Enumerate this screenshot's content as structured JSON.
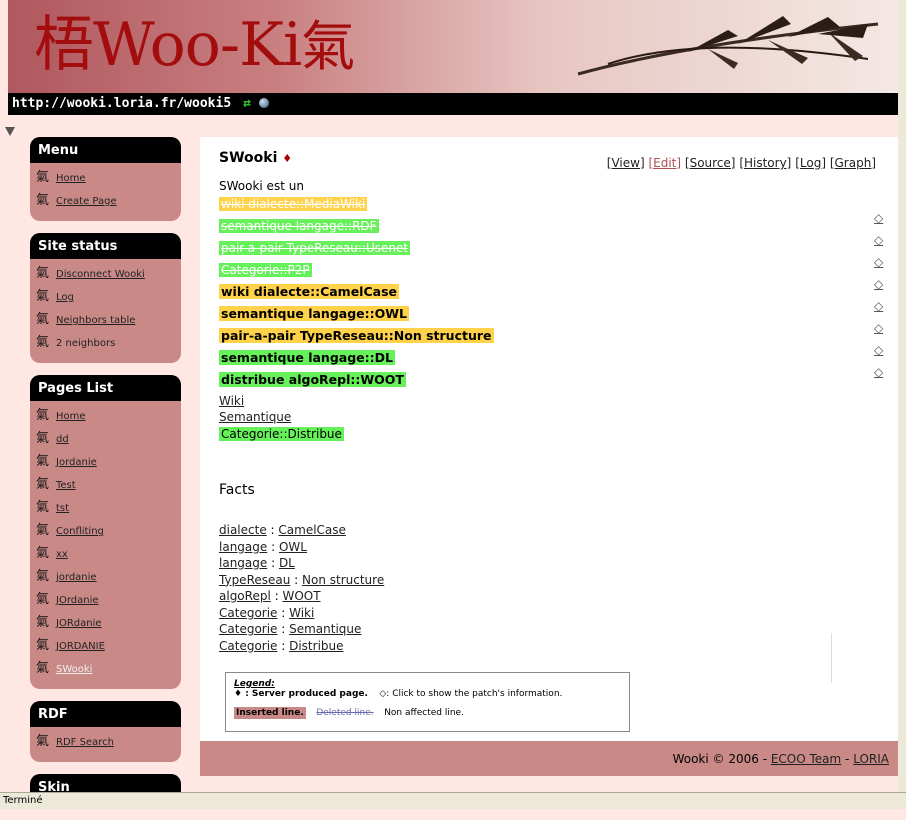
{
  "header": {
    "logo_prefix": "梧",
    "logo_main": "Woo-Ki",
    "logo_suffix": "氣",
    "url": "http://wooki.loria.fr/wooki5"
  },
  "sidebar": {
    "menu": {
      "title": "Menu",
      "items": [
        "Home",
        "Create Page"
      ]
    },
    "site_status": {
      "title": "Site status",
      "items": [
        "Disconnect Wooki",
        "Log",
        "Neighbors table",
        "2 neighbors"
      ]
    },
    "pages_list": {
      "title": "Pages List",
      "items": [
        "Home",
        "dd",
        "Jordanie",
        "Test",
        "tst",
        "Confliting",
        "xx",
        "jordanie",
        "JOrdanie",
        "JORdanie",
        "JORDANIE",
        "SWooki"
      ]
    },
    "rdf": {
      "title": "RDF",
      "items": [
        "RDF Search"
      ]
    },
    "skin": {
      "title": "Skin"
    },
    "item_icon": "氣"
  },
  "page": {
    "title": "SWooki",
    "title_mark": "♦",
    "actions": [
      "[View]",
      "[Edit]",
      "[Source]",
      "[History]",
      "[Log]",
      "[Graph]"
    ],
    "intro": "SWooki est un",
    "deleted_lines": [
      "wiki dialecte::MediaWiki",
      "semantique langage::RDF",
      "pair-a-pair TypeReseau::Usenet",
      "Categorie::P2P"
    ],
    "inserted_lines": [
      "wiki dialecte::CamelCase",
      "semantique langage::OWL",
      "pair-a-pair TypeReseau::Non structure",
      "semantique langage::DL",
      "distribue algoRepl::WOOT"
    ],
    "plain_links": [
      "Wiki",
      "Semantique"
    ],
    "category_line": "Categorie::Distribue",
    "patch_icon": "◇"
  },
  "facts": {
    "title": "Facts",
    "rows": [
      {
        "prop": "dialecte",
        "val": "CamelCase"
      },
      {
        "prop": "langage",
        "val": "OWL"
      },
      {
        "prop": "langage",
        "val": "DL"
      },
      {
        "prop": "TypeReseau",
        "val": "Non structure"
      },
      {
        "prop": "algoRepl",
        "val": "WOOT"
      },
      {
        "prop": "Categorie",
        "val": "Wiki"
      },
      {
        "prop": "Categorie",
        "val": "Semantique"
      },
      {
        "prop": "Categorie",
        "val": "Distribue"
      }
    ],
    "separator": " : "
  },
  "legend": {
    "title": "Legend:",
    "server_mark": "♦ : Server produced page.",
    "patch_info": "◇: Click to show the patch's information.",
    "inserted": "Inserted line.",
    "deleted": "Deleted line.",
    "non_affected": "Non affected line."
  },
  "footer": {
    "prefix": "Wooki © 2006 - ",
    "team": "ECOO Team",
    "dash": " - ",
    "lab": "LORIA"
  },
  "statusbar": {
    "text": "Terminé"
  }
}
